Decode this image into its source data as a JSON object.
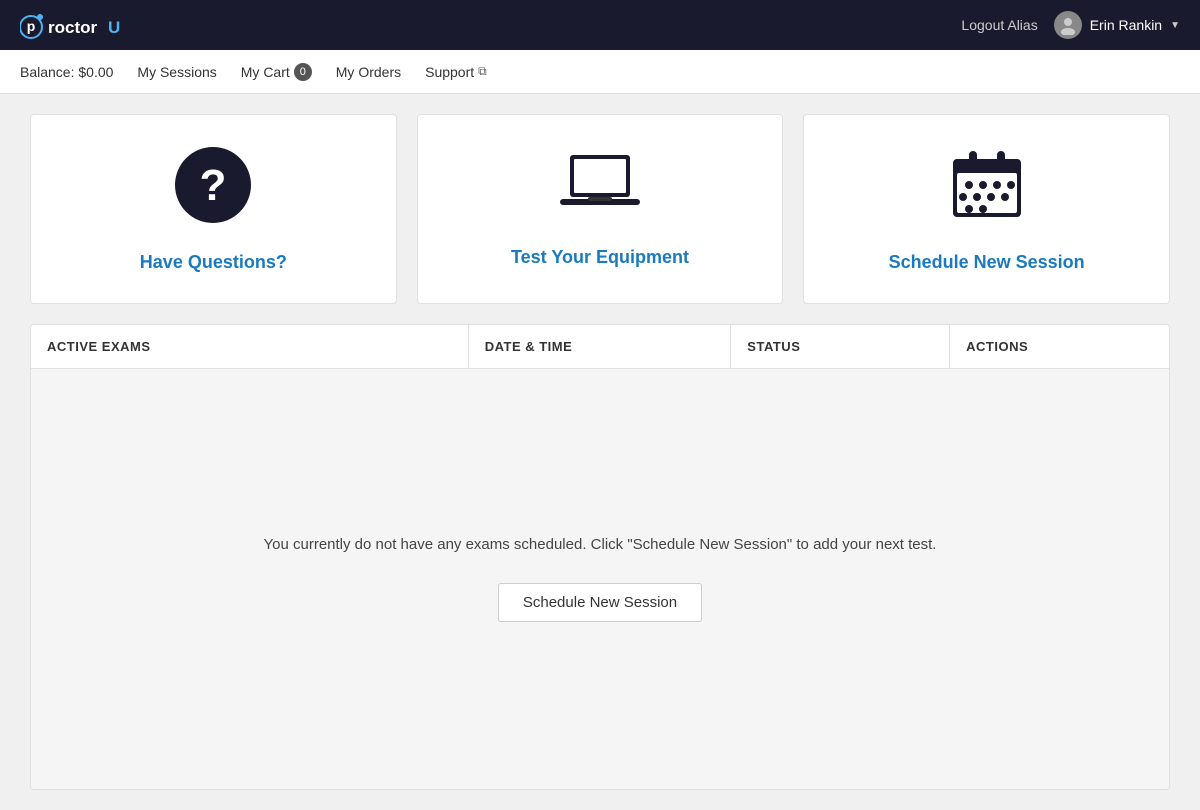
{
  "navbar": {
    "brand": "proctorU",
    "logout_label": "Logout Alias",
    "user_name": "Erin Rankin",
    "user_dropdown_icon": "chevron-down"
  },
  "subnav": {
    "balance_label": "Balance: $0.00",
    "my_sessions_label": "My Sessions",
    "my_cart_label": "My Cart",
    "cart_count": "0",
    "my_orders_label": "My Orders",
    "support_label": "Support"
  },
  "cards": [
    {
      "id": "have-questions",
      "icon": "?",
      "link_text": "Have Questions?"
    },
    {
      "id": "test-equipment",
      "icon": "laptop",
      "link_text": "Test Your Equipment"
    },
    {
      "id": "schedule-session",
      "icon": "calendar",
      "link_text": "Schedule New Session"
    }
  ],
  "table": {
    "columns": [
      "ACTIVE EXAMS",
      "DATE & TIME",
      "STATUS",
      "ACTIONS"
    ],
    "empty_message": "You currently do not have any exams scheduled. Click \"Schedule New Session\" to add your next test.",
    "schedule_btn_label": "Schedule New Session"
  }
}
